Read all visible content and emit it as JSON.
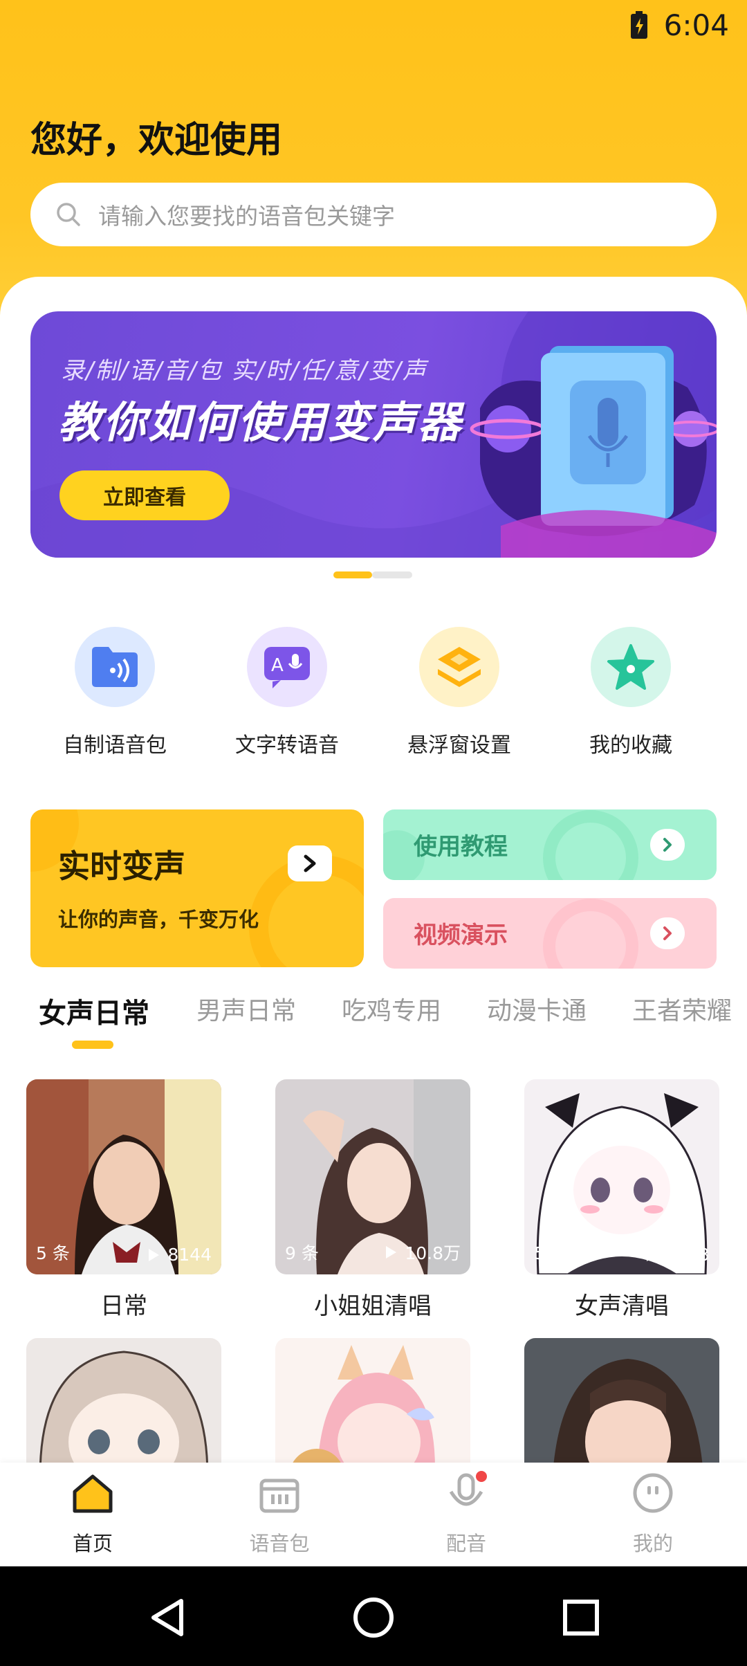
{
  "status_bar": {
    "time": "6:04",
    "battery_icon": "battery-charging-icon"
  },
  "header": {
    "greeting": "您好，欢迎使用",
    "search_placeholder": "请输入您要找的语音包关键字"
  },
  "banner": {
    "subtitle": "录/制/语/音/包     实/时/任/意/变/声",
    "title": "教你如何使用变声器",
    "button": "立即查看",
    "page_index": 1,
    "page_count": 2
  },
  "quick_actions": [
    {
      "label": "自制语音包",
      "icon": "folder-voice-icon"
    },
    {
      "label": "文字转语音",
      "icon": "text-to-speech-icon"
    },
    {
      "label": "悬浮窗设置",
      "icon": "layers-icon"
    },
    {
      "label": "我的收藏",
      "icon": "star-icon"
    }
  ],
  "feature_cards": {
    "realtime": {
      "title": "实时变声",
      "subtitle": "让你的声音，千变万化"
    },
    "tutorial": {
      "label": "使用教程"
    },
    "video": {
      "label": "视频演示"
    }
  },
  "tabs": [
    "女声日常",
    "男声日常",
    "吃鸡专用",
    "动漫卡通",
    "王者荣耀"
  ],
  "active_tab": 0,
  "voice_packs": [
    {
      "title": "日常",
      "count": "5 条",
      "plays": "8144"
    },
    {
      "title": "小姐姐清唱",
      "count": "9 条",
      "plays": "10.8万"
    },
    {
      "title": "女声清唱",
      "count": "5 条",
      "plays": "3343"
    },
    {
      "title": "",
      "count": "",
      "plays": ""
    },
    {
      "title": "",
      "count": "",
      "plays": ""
    },
    {
      "title": "",
      "count": "",
      "plays": ""
    }
  ],
  "bottom_nav": [
    {
      "label": "首页",
      "icon": "home-icon",
      "active": true
    },
    {
      "label": "语音包",
      "icon": "voice-pack-icon",
      "active": false
    },
    {
      "label": "配音",
      "icon": "microphone-icon",
      "active": false,
      "badge": true
    },
    {
      "label": "我的",
      "icon": "profile-icon",
      "active": false
    }
  ],
  "colors": {
    "brand_yellow": "#ffc21a",
    "banner_purple": "#7b4fe0",
    "tutorial_green": "#a4f2d2",
    "video_pink": "#ffd1d8"
  }
}
